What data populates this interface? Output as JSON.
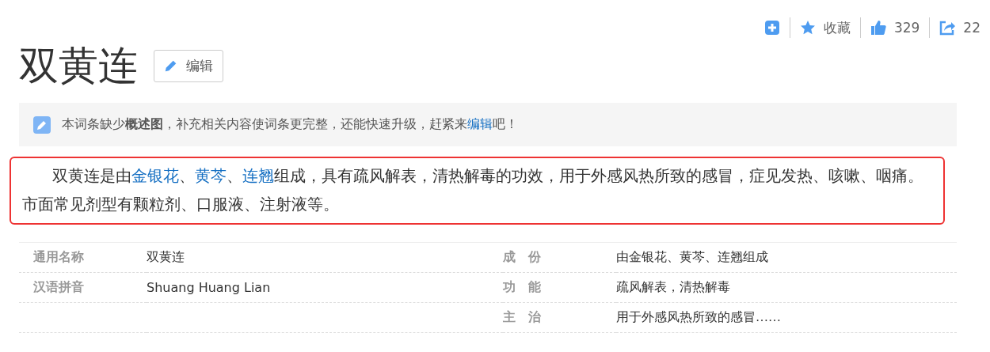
{
  "actions": [
    {
      "kind": "add"
    },
    {
      "kind": "star",
      "label": "收藏"
    },
    {
      "kind": "like",
      "label": "329"
    },
    {
      "kind": "share",
      "label": "22"
    }
  ],
  "title": "双黄连",
  "edit_button": "编辑",
  "notice": [
    {
      "kind": "text",
      "text": "本词条缺少"
    },
    {
      "kind": "bold",
      "text": "概述图"
    },
    {
      "kind": "text",
      "text": "，补充相关内容使词条更完整，还能快速升级，赶紧来"
    },
    {
      "kind": "link",
      "text": "编辑"
    },
    {
      "kind": "text",
      "text": "吧！"
    }
  ],
  "summary": [
    {
      "kind": "text",
      "text": "双黄连是由"
    },
    {
      "kind": "link",
      "text": "金银花"
    },
    {
      "kind": "text",
      "text": "、"
    },
    {
      "kind": "link",
      "text": "黄芩"
    },
    {
      "kind": "text",
      "text": "、"
    },
    {
      "kind": "link",
      "text": "连翘"
    },
    {
      "kind": "text",
      "text": "组成，具有疏风解表，清热解毒的功效，用于外感风热所致的感冒，症见发热、咳嗽、咽痛。市面常见剂型有颗粒剂、口服液、注射液等。"
    }
  ],
  "info_rows": [
    {
      "label_1": "通用名称",
      "value_1": "双黄连",
      "label_2": "成　份",
      "value_2": "由金银花、黄芩、连翘组成"
    },
    {
      "label_1": "汉语拼音",
      "value_1": "Shuang Huang Lian",
      "label_2": "功　能",
      "value_2": "疏风解表，清热解毒"
    },
    {
      "label_2": "主　治",
      "value_2": "用于外感风热所致的感冒……"
    }
  ]
}
